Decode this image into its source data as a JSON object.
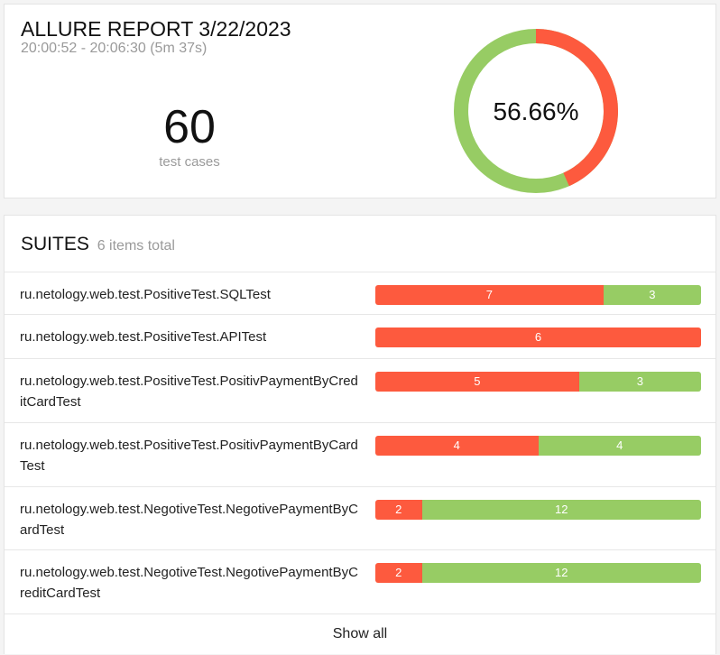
{
  "summary": {
    "title": "ALLURE REPORT 3/22/2023",
    "time_range": "20:00:52 - 20:06:30 (5m 37s)",
    "test_count": "60",
    "test_count_label": "test cases",
    "percent_label": "56.66%",
    "passed_fraction": 0.5666,
    "colors": {
      "failed": "#fd5a3e",
      "passed": "#97cc64"
    }
  },
  "suites": {
    "heading": "SUITES",
    "total_label": "6 items total",
    "items": [
      {
        "name": "ru.netology.web.test.PositiveTest.SQLTest",
        "failed": 7,
        "passed": 3
      },
      {
        "name": "ru.netology.web.test.PositiveTest.APITest",
        "failed": 6,
        "passed": 0
      },
      {
        "name": "ru.netology.web.test.PositiveTest.PositivPaymentByCreditCardTest",
        "failed": 5,
        "passed": 3
      },
      {
        "name": "ru.netology.web.test.PositiveTest.PositivPaymentByCardTest",
        "failed": 4,
        "passed": 4
      },
      {
        "name": "ru.netology.web.test.NegotiveTest.NegotivePaymentByCardTest",
        "failed": 2,
        "passed": 12
      },
      {
        "name": "ru.netology.web.test.NegotiveTest.NegotivePaymentByCreditCardTest",
        "failed": 2,
        "passed": 12
      }
    ],
    "show_all_label": "Show all"
  }
}
